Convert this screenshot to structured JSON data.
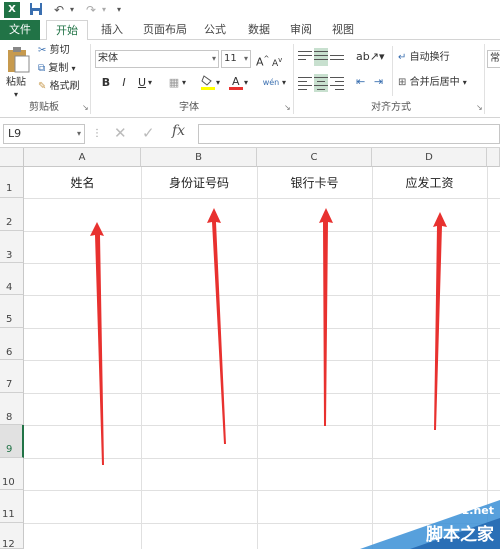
{
  "quick_access": {
    "icons": [
      "excel-logo-icon",
      "save-icon",
      "undo-icon",
      "redo-icon",
      "customize-icon"
    ]
  },
  "tabs": [
    {
      "label": "文件"
    },
    {
      "label": "开始"
    },
    {
      "label": "插入"
    },
    {
      "label": "页面布局"
    },
    {
      "label": "公式"
    },
    {
      "label": "数据"
    },
    {
      "label": "审阅"
    },
    {
      "label": "视图"
    }
  ],
  "ribbon": {
    "clipboard": {
      "paste": "粘贴",
      "cut": "剪切",
      "copy": "复制",
      "format_painter": "格式刷",
      "group_label": "剪贴板"
    },
    "font": {
      "font_name": "宋体",
      "font_size": "11",
      "bold": "B",
      "italic": "I",
      "underline": "U",
      "group_label": "字体"
    },
    "alignment": {
      "wrap_text": "自动换行",
      "merge_center": "合并后居中",
      "group_label": "对齐方式"
    },
    "number": {
      "format": "常"
    }
  },
  "formula_bar": {
    "name_box": "L9",
    "fx": "fx",
    "content": ""
  },
  "sheet": {
    "columns": [
      "A",
      "B",
      "C",
      "D"
    ],
    "rows": [
      "1",
      "2",
      "3",
      "4",
      "5",
      "6",
      "7",
      "8",
      "9",
      "10",
      "11",
      "12"
    ],
    "headers": [
      "姓名",
      "身份证号码",
      "银行卡号",
      "应发工资"
    ],
    "selected_row": "9"
  },
  "watermark": {
    "site": "jb51.net",
    "name": "脚本之家"
  },
  "colors": {
    "excel_green": "#217346",
    "arrow_red": "#e8312f"
  }
}
